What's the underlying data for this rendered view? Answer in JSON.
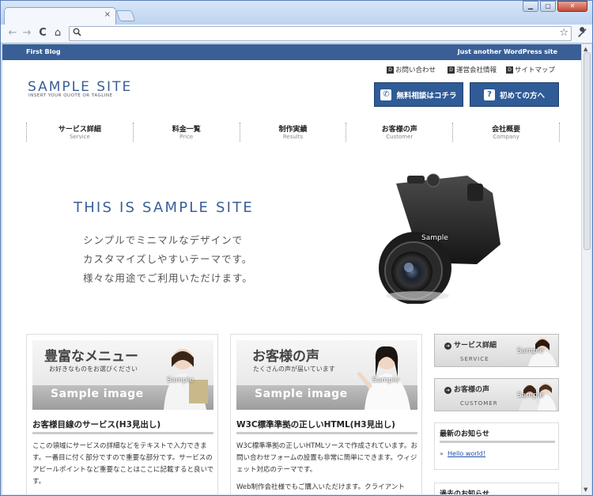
{
  "browser": {
    "tab_close": "×",
    "window_buttons": {
      "minimize": "▁",
      "maximize": "▢",
      "close": "✕"
    },
    "nav": {
      "back": "←",
      "forward": "→",
      "reload": "C",
      "home": "⌂"
    },
    "omnibox_icon": "search-icon",
    "star": "☆",
    "wrench": "wrench-icon"
  },
  "site": {
    "topbar": {
      "left": "First Blog",
      "right": "Just another WordPress site"
    },
    "logo": "SAMPLE SITE",
    "tagline": "INSERT YOUR QUOTE OR TAGLINE",
    "header_links": [
      {
        "label": "お問い合わせ"
      },
      {
        "label": "運営会社情報"
      },
      {
        "label": "サイトマップ"
      }
    ],
    "cta": [
      {
        "label": "無料相談はコチラ",
        "icon": "phone-icon"
      },
      {
        "label": "初めての方へ",
        "icon": "question-icon"
      }
    ],
    "gnav": [
      {
        "jp": "サービス詳細",
        "en": "Service"
      },
      {
        "jp": "料金一覧",
        "en": "Price"
      },
      {
        "jp": "制作実績",
        "en": "Results"
      },
      {
        "jp": "お客様の声",
        "en": "Customer"
      },
      {
        "jp": "会社概要",
        "en": "Company"
      }
    ],
    "hero": {
      "title": "THIS IS SAMPLE SITE",
      "lines": [
        "シンプルでミニマルなデザインで",
        "カスタマイズしやすいテーマです。",
        "様々な用途でご利用いただけます。"
      ],
      "camera_label": "Sample"
    },
    "columns": [
      {
        "banner_title": "豊富なメニュー",
        "banner_sub": "お好きなものをお選びください",
        "banner_image": "Sample image",
        "person_label": "Sample",
        "heading": "お客様目線のサービス(H3見出し)",
        "paragraphs": [
          "ここの領域にサービスの詳細などをテキストで入力できます。一番目に付く部分ですので重要な部分です。サービスのアピールポイントなど重要なことはここに記載すると良いです。"
        ]
      },
      {
        "banner_title": "お客様の声",
        "banner_sub": "たくさんの声が届いています",
        "banner_image": "Sample image",
        "person_label": "Sample",
        "heading": "W3C標準準拠の正しいHTML(H3見出し)",
        "paragraphs": [
          "W3C標準準拠の正しいHTMLソースで作成されています。お問い合わせフォームの設置も非常に簡単にできます。ウィジェット対応のテーマです。",
          "Web制作会社様でもご購入いただけます。クライアント"
        ]
      }
    ],
    "sidebar": {
      "banners": [
        {
          "title": "サービス詳細",
          "en": "SERVICE",
          "person_label": "Sample"
        },
        {
          "title": "お客様の声",
          "en": "CUSTOMER",
          "person_label": "Sample"
        }
      ],
      "news": {
        "title": "最新のお知らせ",
        "link": "Hello world!"
      },
      "archive_title": "過去のお知らせ"
    }
  }
}
